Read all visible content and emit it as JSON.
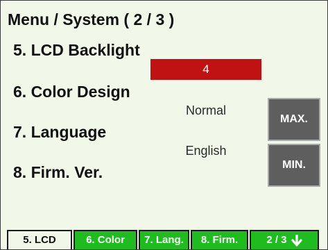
{
  "title": "Menu / System ( 2 / 3 )",
  "items": [
    {
      "label": "5. LCD Backlight",
      "value": "4"
    },
    {
      "label": "6. Color Design",
      "value": "Normal"
    },
    {
      "label": "7. Language",
      "value": "English"
    },
    {
      "label": "8. Firm. Ver.",
      "value": ""
    }
  ],
  "buttons": {
    "max": "MAX.",
    "min": "MIN."
  },
  "tabs": [
    {
      "label": "5. LCD",
      "active": true
    },
    {
      "label": "6. Color",
      "active": false
    },
    {
      "label": "7. Lang.",
      "active": false
    },
    {
      "label": "8. Firm.",
      "active": false
    },
    {
      "label": "2 / 3",
      "active": false,
      "icon": "arrow-down-icon"
    }
  ],
  "colors": {
    "background": "#f1f8ea",
    "value_bar": "#c01212",
    "tab_green": "#1fbc1f",
    "button_gray": "#5e5e5e"
  }
}
